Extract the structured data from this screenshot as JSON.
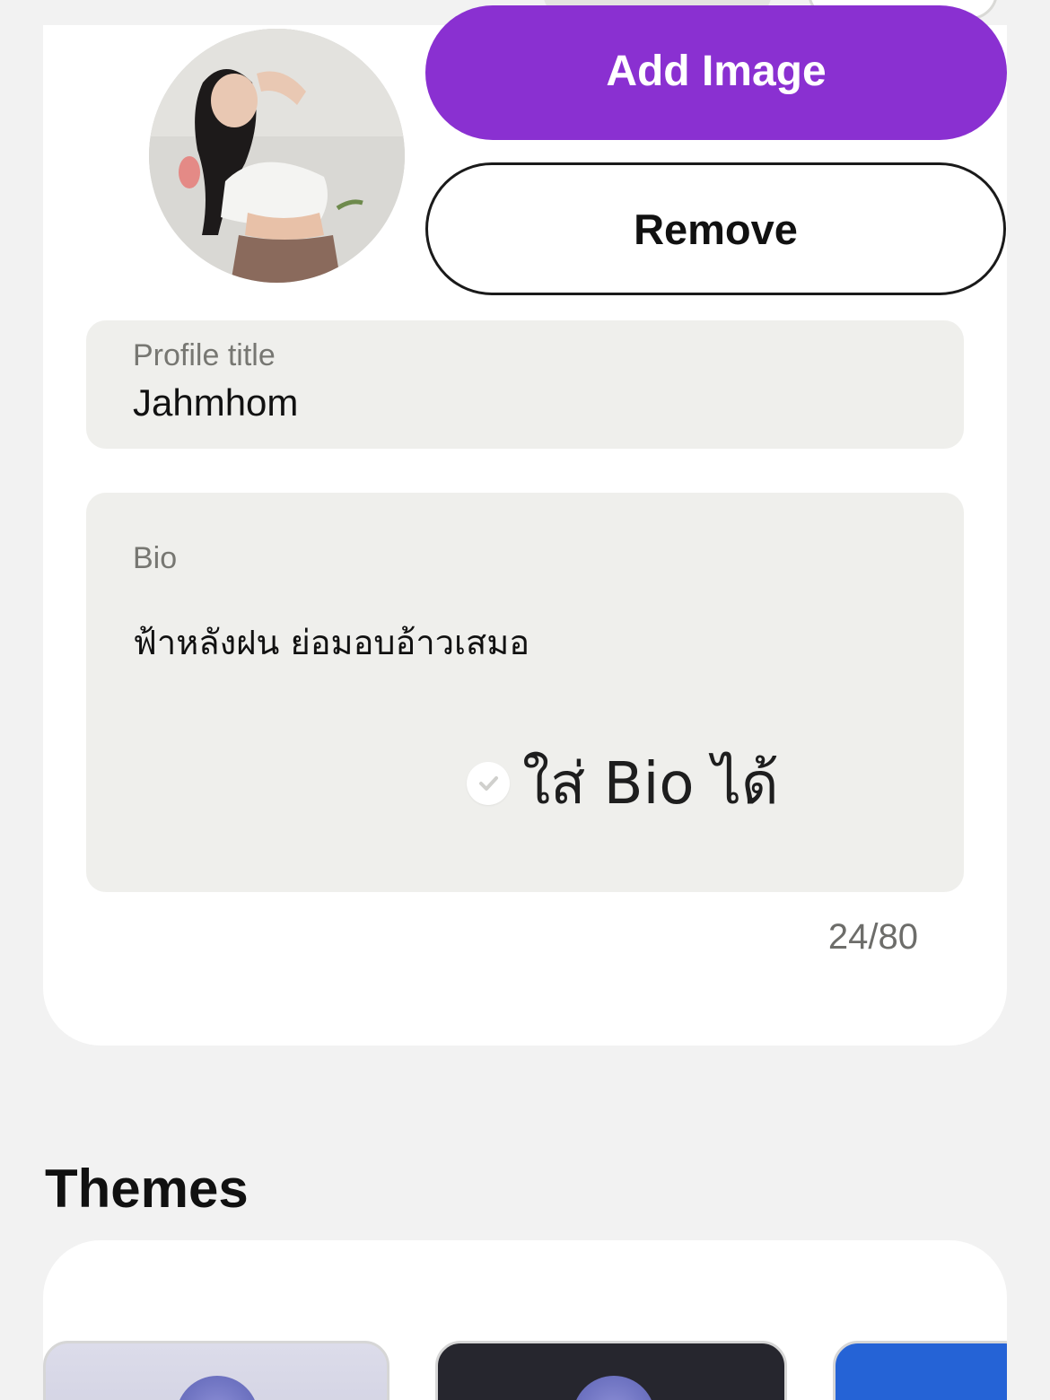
{
  "profile": {
    "add_image_label": "Add Image",
    "remove_label": "Remove",
    "title_field": {
      "label": "Profile title",
      "value": "Jahmhom"
    },
    "bio_field": {
      "label": "Bio",
      "value": "ฟ้าหลังฝน ย่อมอบอ้าวเสมอ",
      "counter": "24/80"
    },
    "overlay_sticker": {
      "text": "ใส่ Bio ได้",
      "icon": "check-circle-icon"
    }
  },
  "themes": {
    "heading": "Themes"
  },
  "colors": {
    "accent": "#8a30d1",
    "background": "#f2f2f2",
    "field_bg": "#efefec",
    "theme_blue": "#2563d6",
    "theme_dark": "#26262e"
  }
}
